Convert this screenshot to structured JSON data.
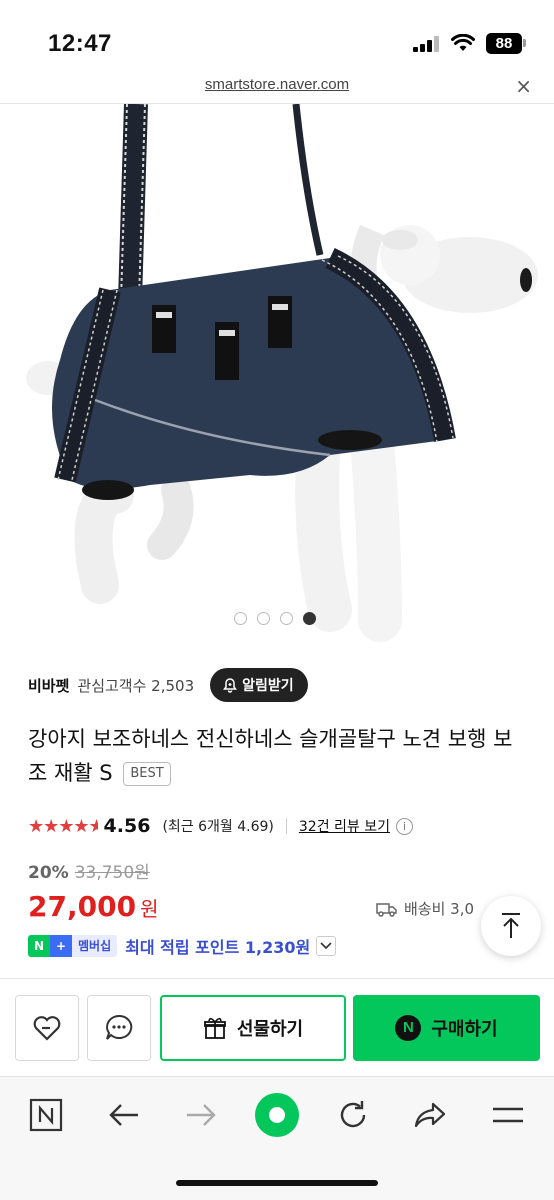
{
  "status_bar": {
    "time": "12:47",
    "battery": "88"
  },
  "url_bar": {
    "url": "smartstore.naver.com",
    "close_icon": "×"
  },
  "gallery": {
    "total": 4,
    "active_index": 3
  },
  "seller": {
    "name": "비바펫",
    "followers_label": "관심고객수 2,503",
    "alarm_label": "알림받기"
  },
  "product": {
    "title": "강아지 보조하네스 전신하네스 슬개골탈구 노견 보행 보조 재활 S",
    "badge": "BEST",
    "rating": "4.56",
    "rating_stars": 4.56,
    "recent_rating": "(최근 6개월 4.69)",
    "reviews_link": "32건 리뷰 보기",
    "discount": "20%",
    "original_price": "33,750원",
    "price": "27,000",
    "price_unit": "원",
    "shipping": "배송비 3,0"
  },
  "membership": {
    "badge_n": "N",
    "badge_plus": "+",
    "badge_label": "멤버십",
    "text": "최대 적립 포인트 1,230원"
  },
  "actions": {
    "gift_label": "선물하기",
    "buy_label": "구매하기",
    "buy_badge": "N"
  },
  "colors": {
    "naver_green": "#03c75a",
    "price_red": "#e0201f",
    "star_red": "#e23e3e",
    "membership_blue": "#3a4fd0"
  },
  "toolbar": {
    "n_label": "N"
  }
}
